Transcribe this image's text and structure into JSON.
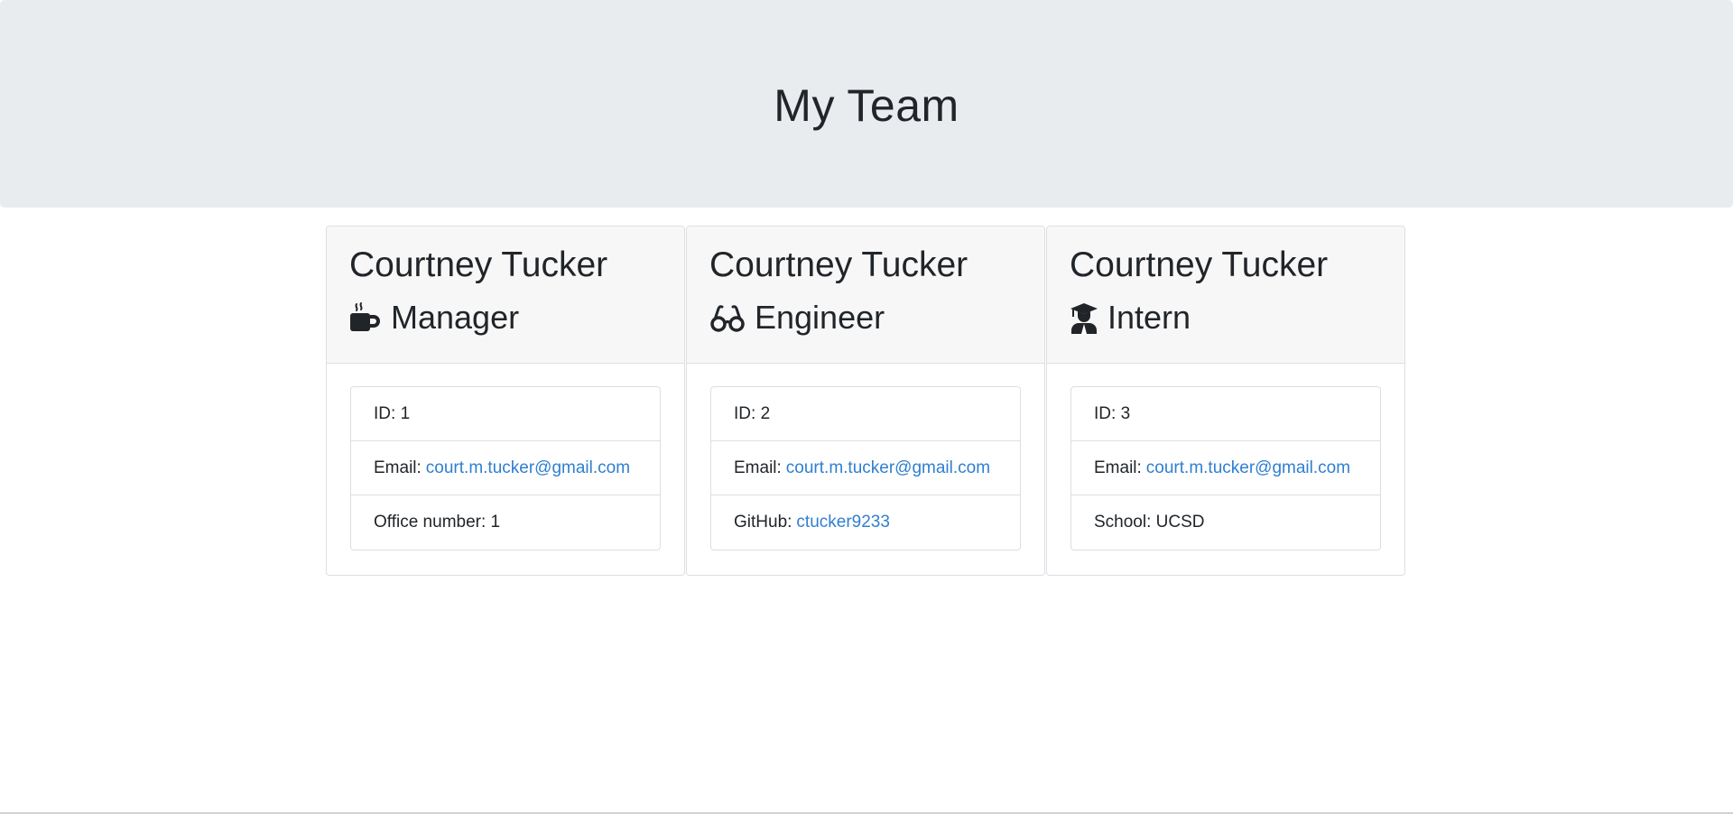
{
  "header": {
    "title": "My Team"
  },
  "team": [
    {
      "name": "Courtney Tucker",
      "role": "Manager",
      "icon": "coffee-mug-icon",
      "id_label": "ID:",
      "id_value": "1",
      "email_label": "Email:",
      "email": "court.m.tucker@gmail.com",
      "extra_label": "Office number:",
      "extra_value": "1"
    },
    {
      "name": "Courtney Tucker",
      "role": "Engineer",
      "icon": "glasses-icon",
      "id_label": "ID:",
      "id_value": "2",
      "email_label": "Email:",
      "email": "court.m.tucker@gmail.com",
      "extra_label": "GitHub:",
      "extra_value": "ctucker9233"
    },
    {
      "name": "Courtney Tucker",
      "role": "Intern",
      "icon": "graduate-icon",
      "id_label": "ID:",
      "id_value": "3",
      "email_label": "Email:",
      "email": "court.m.tucker@gmail.com",
      "extra_label": "School:",
      "extra_value": "UCSD"
    }
  ],
  "colors": {
    "header_bg": "#e9ecef",
    "card_header_bg": "#f7f7f7",
    "link": "#2f7fd0",
    "text": "#212529"
  }
}
